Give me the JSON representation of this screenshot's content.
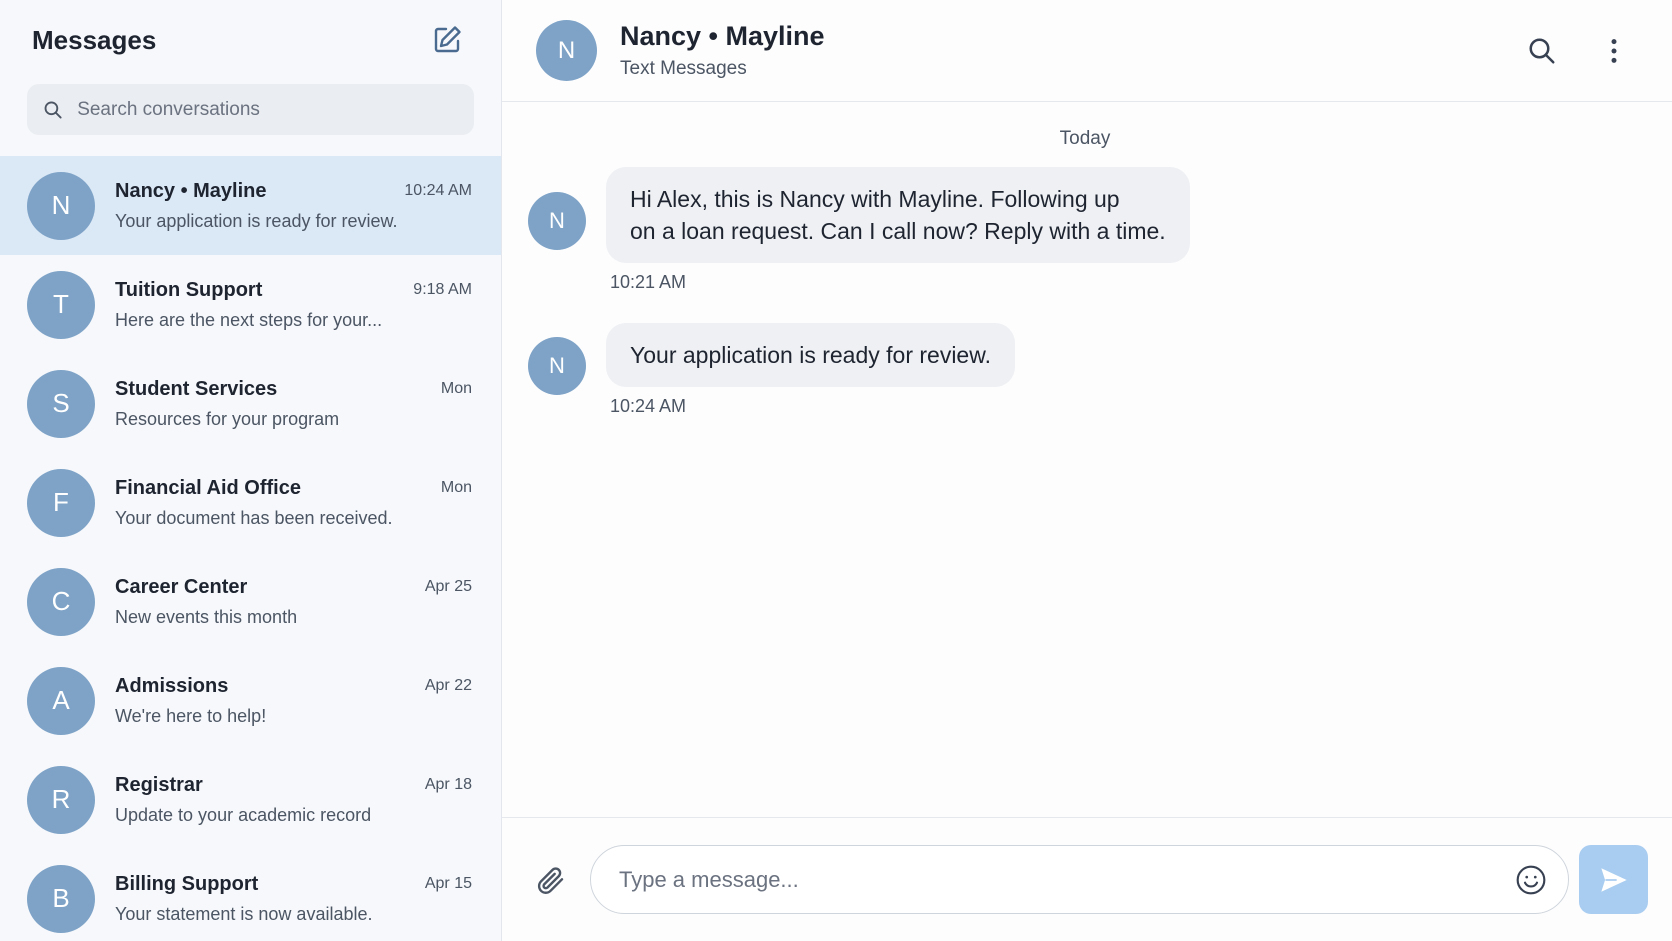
{
  "sidebar": {
    "title": "Messages",
    "compose_icon": "compose-icon",
    "search": {
      "placeholder": "Search conversations",
      "icon": "search-icon"
    },
    "conversations": [
      {
        "initial": "N",
        "name": "Nancy • Mayline",
        "time": "10:24 AM",
        "snippet": "Your application is ready for review.",
        "active": true
      },
      {
        "initial": "T",
        "name": "Tuition Support",
        "time": "9:18 AM",
        "snippet": "Here are the next steps for your..."
      },
      {
        "initial": "S",
        "name": "Student Services",
        "time": "Mon",
        "snippet": "Resources for your program"
      },
      {
        "initial": "F",
        "name": "Financial Aid Office",
        "time": "Mon",
        "snippet": "Your document has been received."
      },
      {
        "initial": "C",
        "name": "Career Center",
        "time": "Apr 25",
        "snippet": "New events this month"
      },
      {
        "initial": "A",
        "name": "Admissions",
        "time": "Apr 22",
        "snippet": "We're here to help!"
      },
      {
        "initial": "R",
        "name": "Registrar",
        "time": "Apr 18",
        "snippet": "Update to your academic record"
      },
      {
        "initial": "B",
        "name": "Billing Support",
        "time": "Apr 15",
        "snippet": "Your statement is now available."
      }
    ]
  },
  "chat": {
    "header": {
      "initial": "N",
      "name": "Nancy • Mayline",
      "subtitle": "Text Messages"
    },
    "day_label": "Today",
    "messages": [
      {
        "initial": "N",
        "text_line1": "Hi Alex, this is Nancy with Mayline. Following up",
        "text_line2": "on a loan request. Can I call now? Reply with a time.",
        "time": "10:21 AM"
      },
      {
        "initial": "N",
        "text": "Your application is ready for review.",
        "time": "10:24 AM"
      }
    ],
    "composer": {
      "placeholder": "Type a message..."
    }
  },
  "colors": {
    "avatar": "#7ea3c7",
    "active_row": "#dbe8f6",
    "bubble": "#eef0f3",
    "send_button": "#a9cdf0"
  }
}
